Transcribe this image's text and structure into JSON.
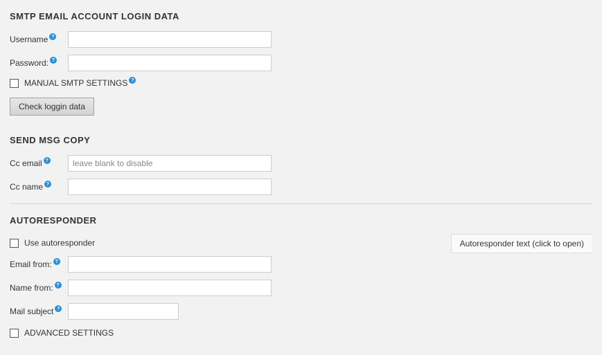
{
  "smtp": {
    "heading": "SMTP EMAIL ACCOUNT LOGIN DATA",
    "username_label": "Username",
    "password_label": "Password:",
    "manual_label": "MANUAL SMTP SETTINGS",
    "check_button": "Check loggin data"
  },
  "copy": {
    "heading": "SEND MSG COPY",
    "cc_email_label": "Cc email",
    "cc_email_placeholder": "leave blank to disable",
    "cc_name_label": "Cc name"
  },
  "auto": {
    "heading": "AUTORESPONDER",
    "use_label": "Use autoresponder",
    "email_from_label": "Email from:",
    "name_from_label": "Name from:",
    "subject_label": "Mail subject",
    "side_toggle": "Autoresponder text (click to open)",
    "advanced_label": "ADVANCED SETTINGS"
  },
  "help_glyph": "?"
}
